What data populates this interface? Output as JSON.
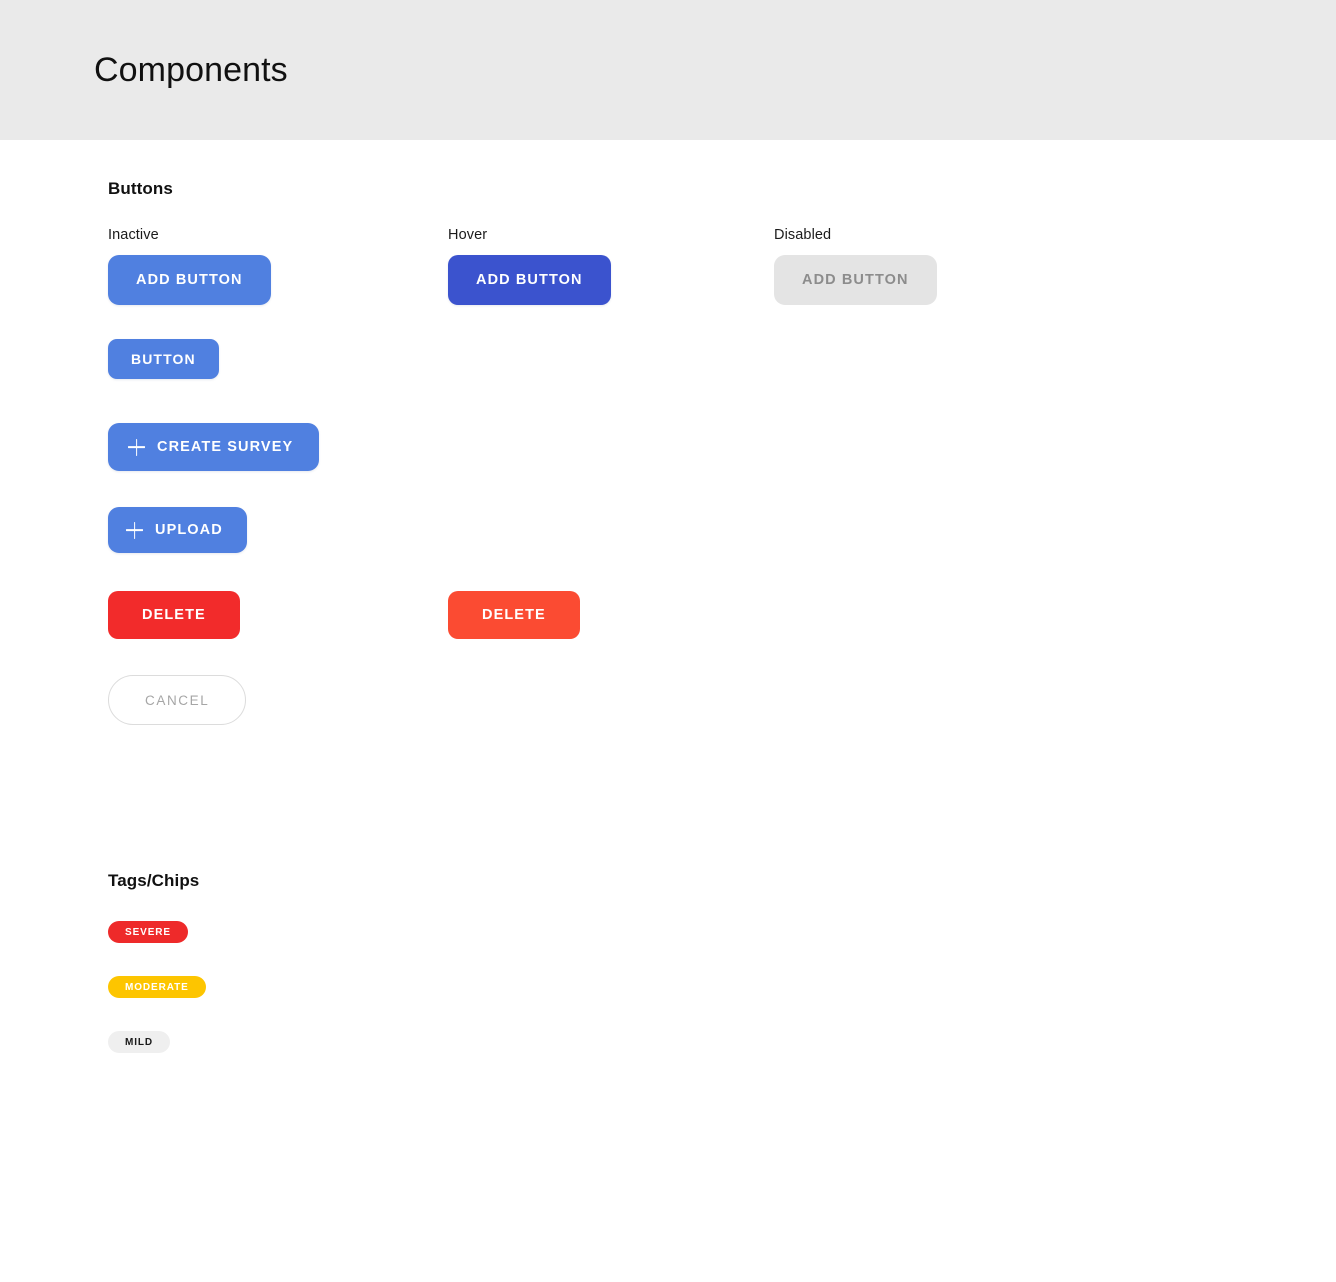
{
  "header": {
    "title": "Components",
    "background": "#eaeaea"
  },
  "colors": {
    "primary": "#5080e0",
    "primary_hover": "#3b53ce",
    "disabled_bg": "#e4e4e4",
    "disabled_text": "#8c8c8c",
    "danger": "#f22b2b",
    "danger_hover": "#fb4b32",
    "chip_severe": "#ee2a2a",
    "chip_moderate": "#fdc500",
    "chip_mild": "#efefef",
    "ghost_border": "#dcdcdc",
    "ghost_text": "#a6a6a6"
  },
  "sections": {
    "buttons": {
      "title": "Buttons",
      "column_labels": {
        "inactive": "Inactive",
        "hover": "Hover",
        "disabled": "Disabled"
      },
      "rows": [
        {
          "name": "add-button",
          "inactive": "ADD BUTTON",
          "hover": "ADD BUTTON",
          "disabled": "ADD BUTTON"
        },
        {
          "name": "button",
          "inactive": "BUTTON"
        },
        {
          "name": "create-survey",
          "icon": "plus-icon",
          "inactive": "CREATE SURVEY"
        },
        {
          "name": "upload",
          "icon": "plus-icon",
          "inactive": "UPLOAD"
        },
        {
          "name": "delete",
          "inactive": "DELETE",
          "hover": "DELETE"
        },
        {
          "name": "cancel",
          "inactive": "CANCEL"
        }
      ]
    },
    "tags": {
      "title": "Tags/Chips",
      "chips": [
        {
          "label": "SEVERE",
          "variant": "severe"
        },
        {
          "label": "MODERATE",
          "variant": "moderate"
        },
        {
          "label": "MILD",
          "variant": "mild"
        }
      ]
    }
  }
}
